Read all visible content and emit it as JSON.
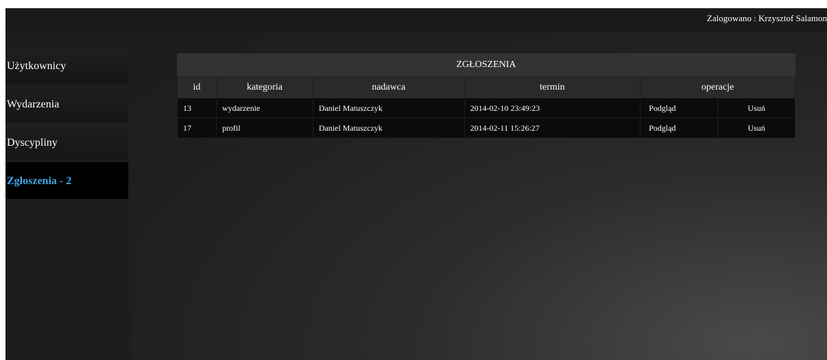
{
  "header": {
    "login_label": "Zalogowano : Krzysztof  Salamon"
  },
  "sidebar": {
    "items": [
      {
        "label": "Użytkownicy",
        "active": false
      },
      {
        "label": "Wydarzenia",
        "active": false
      },
      {
        "label": "Dyscypliny",
        "active": false
      },
      {
        "label": "Zgłoszenia - 2",
        "active": true
      }
    ]
  },
  "table": {
    "title": "ZGŁOSZENIA",
    "columns": [
      "id",
      "kategoria",
      "nadawca",
      "termin",
      "operacje"
    ],
    "rows": [
      {
        "id": "13",
        "kategoria": "wydarzenie",
        "nadawca": "Daniel Matuszczyk",
        "termin": "2014-02-10 23:49:23",
        "preview": "Podgląd",
        "delete": "Usuń"
      },
      {
        "id": "17",
        "kategoria": "profil",
        "nadawca": "Daniel Matuszczyk",
        "termin": "2014-02-11 15:26:27",
        "preview": "Podgląd",
        "delete": "Usuń"
      }
    ]
  },
  "colors": {
    "background": "#1c1c1c",
    "active_link": "#3ea7e0",
    "text": "#ffffff"
  }
}
